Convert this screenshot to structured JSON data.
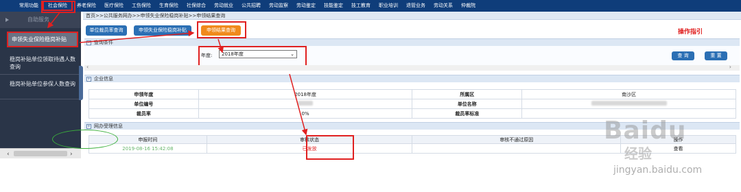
{
  "topnav": {
    "items": [
      "常用功能",
      "社会保险",
      "养老保险",
      "医疗保险",
      "工伤保险",
      "生育保险",
      "社保综合",
      "劳动就业",
      "公共招聘",
      "劳动监察",
      "劳动鉴定",
      "技能鉴定",
      "技工教育",
      "职业培训",
      "退管业务",
      "劳动关系",
      "仲裁院"
    ],
    "active_index": 1
  },
  "sidebar": {
    "header": "自助服务",
    "items": [
      {
        "label": "申领失业保险稳岗补贴",
        "active": true
      },
      {
        "label": "稳岗补贴单位领取待遇人数查询",
        "active": false
      },
      {
        "label": "稳岗补贴单位参保人数查询",
        "active": false
      }
    ]
  },
  "breadcrumb": "首页>>公共服务网办>>申领失业保险稳岗补贴>>申领结果查询",
  "buttons": {
    "layoff_query": "单位裁员率查询",
    "apply_subsidy": "申领失业保险稳岗补贴",
    "result_query": "申领结果查询"
  },
  "guide_label": "操作指引",
  "query_section": {
    "title": "查询条件",
    "year_label": "年度:",
    "year_value": "2018年度",
    "query_button": "查 询",
    "reset_button": "重 置"
  },
  "company_section": {
    "title": "企业信息",
    "rows": [
      {
        "l1": "申领年度",
        "v1": "2018年度",
        "l2": "所属区",
        "v2": "南沙区"
      },
      {
        "l1": "单位编号",
        "v1": "",
        "l2": "单位名称",
        "v2": ""
      },
      {
        "l1": "裁员率",
        "v1": "0%",
        "l2": "裁员率标准",
        "v2": ""
      }
    ]
  },
  "process_section": {
    "title": "网办受理信息",
    "headers": [
      "申报时间",
      "审核状态",
      "审核不通过原因",
      "操作"
    ],
    "rows": [
      {
        "time": "2019-08-16 15:42:08",
        "status": "已发放",
        "reason": "",
        "action": "查看"
      }
    ]
  },
  "watermark": {
    "brand": "Baidu",
    "sub": "经验",
    "url": "jingyan.baidu.com"
  },
  "colors": {
    "nav_bg": "#0f3d7a",
    "sidebar_bg": "#2a3548",
    "button_blue": "#2b6fb4",
    "button_orange": "#f08a1c",
    "annotation_red": "#e02020",
    "annotation_green": "#3bb03b"
  }
}
